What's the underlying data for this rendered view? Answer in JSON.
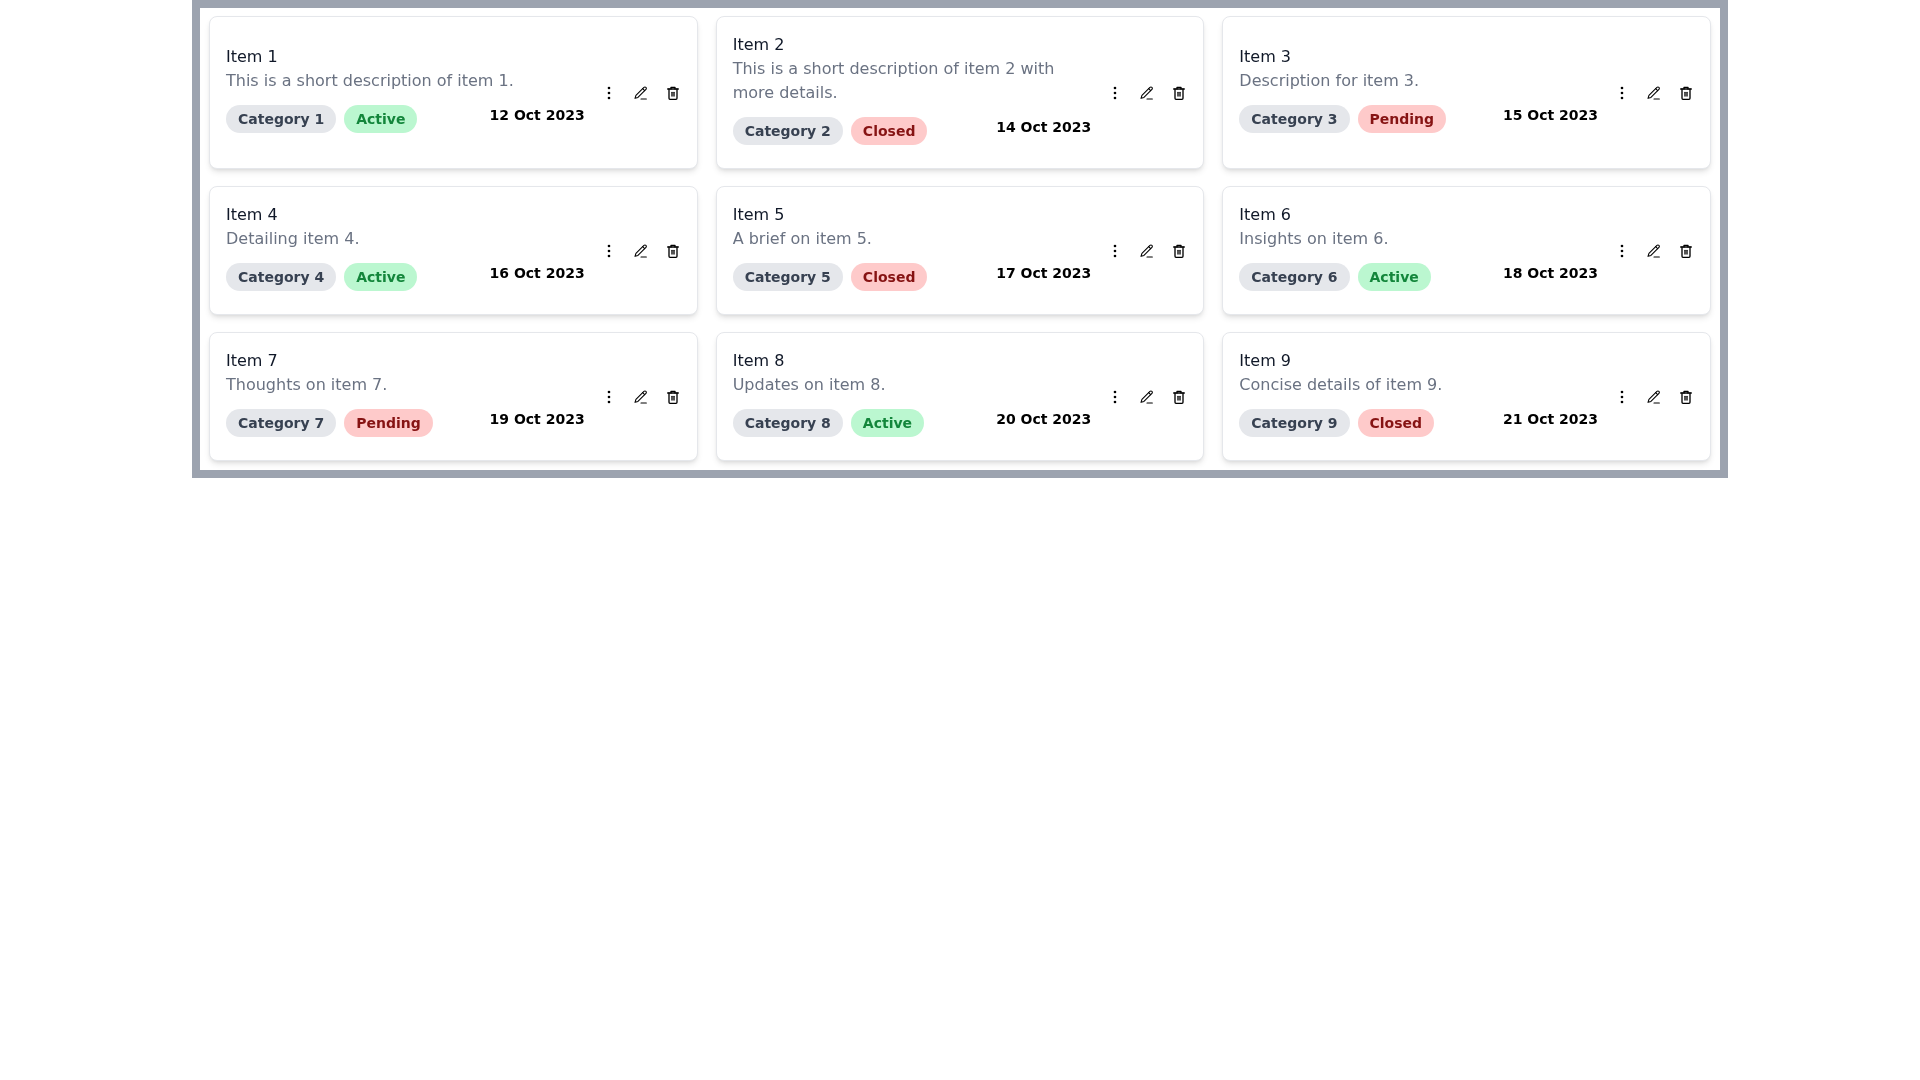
{
  "rows": [
    {
      "cards": [
        {
          "title": "Item 1",
          "description": "This is a short description of item 1.",
          "category": "Category 1",
          "status": {
            "label": "Active",
            "color": "#bbf7d0"
          },
          "date": "12 Oct 2023"
        },
        {
          "title": "Item 2",
          "description": "This is a short description of item 2 with more details.",
          "category": "Category 2",
          "status": {
            "label": "Closed",
            "color": "#fecaca"
          },
          "date": "14 Oct 2023"
        },
        {
          "title": "Item 3",
          "description": "Description for item 3.",
          "category": "Category 3",
          "status": {
            "label": "Pending",
            "color": "#fecaca"
          },
          "date": "15 Oct 2023"
        }
      ]
    },
    {
      "cards": [
        {
          "title": "Item 4",
          "description": "Detailing item 4.",
          "category": "Category 4",
          "status": {
            "label": "Active",
            "color": "#bbf7d0"
          },
          "date": "16 Oct 2023"
        },
        {
          "title": "Item 5",
          "description": "A brief on item 5.",
          "category": "Category 5",
          "status": {
            "label": "Closed",
            "color": "#fecaca"
          },
          "date": "17 Oct 2023"
        },
        {
          "title": "Item 6",
          "description": "Insights on item 6.",
          "category": "Category 6",
          "status": {
            "label": "Active",
            "color": "#bbf7d0"
          },
          "date": "18 Oct 2023"
        }
      ]
    },
    {
      "cards": [
        {
          "title": "Item 7",
          "description": "Thoughts on item 7.",
          "category": "Category 7",
          "status": {
            "label": "Pending",
            "color": "#fecaca"
          },
          "date": "19 Oct 2023"
        },
        {
          "title": "Item 8",
          "description": "Updates on item 8.",
          "category": "Category 8",
          "status": {
            "label": "Active",
            "color": "#bbf7d0"
          },
          "date": "20 Oct 2023"
        },
        {
          "title": "Item 9",
          "description": "Concise details of item 9.",
          "category": "Category 9",
          "status": {
            "label": "Closed",
            "color": "#fecaca"
          },
          "date": "21 Oct 2023"
        }
      ]
    }
  ]
}
